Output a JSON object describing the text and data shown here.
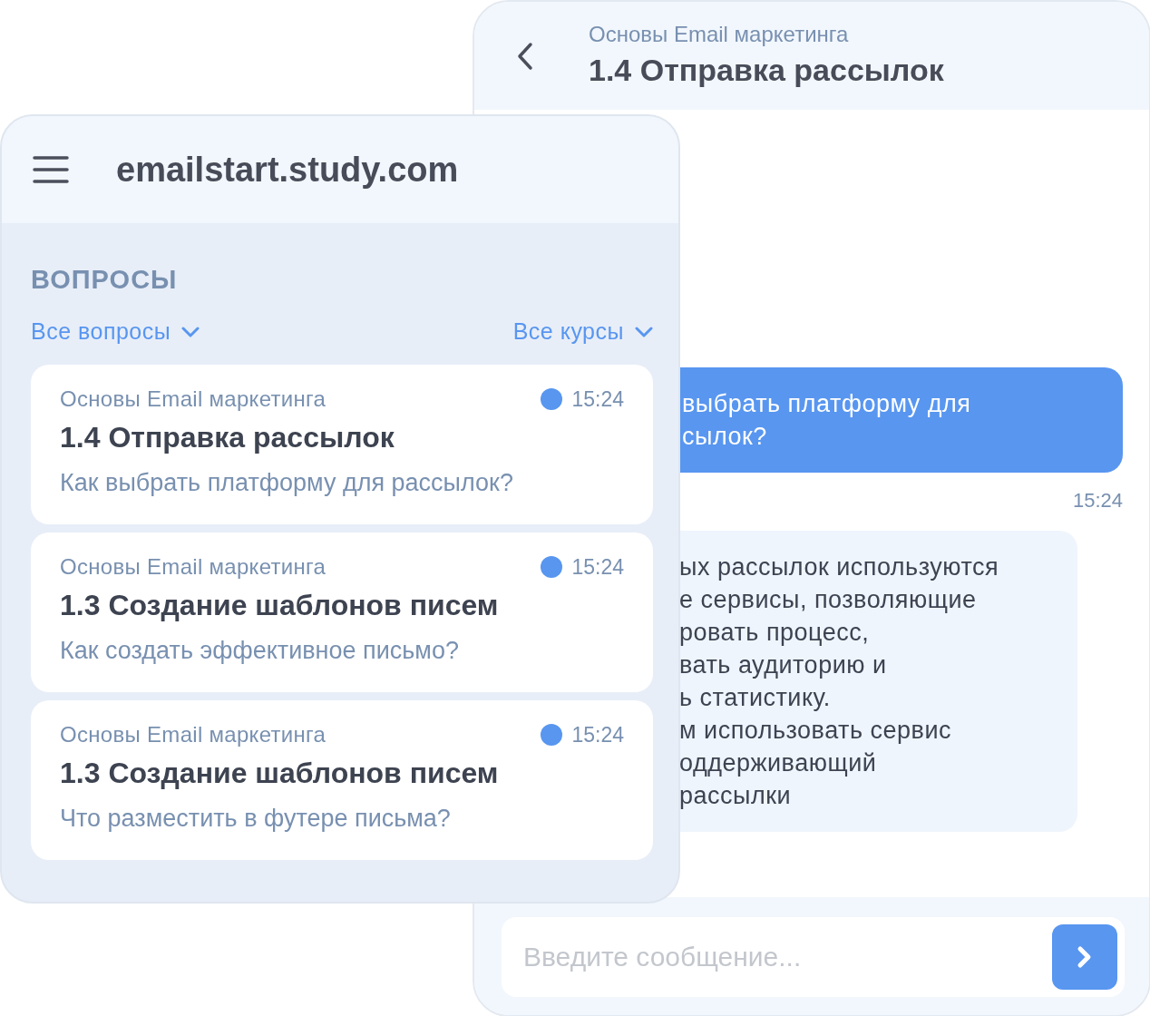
{
  "chat": {
    "course": "Основы Email маркетинга",
    "lesson": "1.4 Отправка рассылок",
    "messages": [
      {
        "kind": "outgoing",
        "lines": [
          "выбрать платформу для",
          "сылок?"
        ],
        "time": "15:24"
      },
      {
        "kind": "incoming",
        "lines": [
          "ых рассылок используются",
          "е сервисы, позволяющие",
          "ровать процесс,",
          "вать аудиторию и",
          "ь статистику.",
          "м использовать сервис",
          "оддерживающий",
          "рассылки"
        ]
      }
    ],
    "input": {
      "placeholder": "Введите сообщение..."
    }
  },
  "questions_panel": {
    "site": "emailstart.study.com",
    "heading": "ВОПРОСЫ",
    "filters": [
      "Все вопросы",
      "Все курсы"
    ],
    "items": [
      {
        "course": "Основы Email маркетинга",
        "time": "15:24",
        "unread": true,
        "lesson": "1.4 Отправка рассылок",
        "question": "Как выбрать платформу для рассылок?"
      },
      {
        "course": "Основы Email маркетинга",
        "time": "15:24",
        "unread": true,
        "lesson": "1.3 Создание шаблонов писем",
        "question": "Как создать эффективное письмо?"
      },
      {
        "course": "Основы Email маркетинга",
        "time": "15:24",
        "unread": true,
        "lesson": "1.3 Создание шаблонов писем",
        "question": "Что разместить в футере письма?"
      }
    ]
  }
}
